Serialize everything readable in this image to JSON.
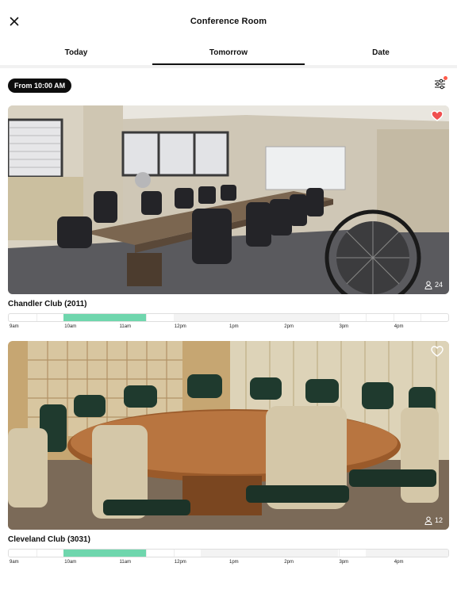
{
  "header": {
    "title": "Conference Room"
  },
  "tabs": [
    {
      "label": "Today",
      "active": false
    },
    {
      "label": "Tomorrow",
      "active": true
    },
    {
      "label": "Date",
      "active": false
    }
  ],
  "filter": {
    "time_chip": "From 10:00 AM",
    "indicator_color": "#ff5b4a"
  },
  "colors": {
    "available": "#6fd6ad",
    "unavailable": "#f3f3f3",
    "free": "#ffffff",
    "favorite": "#f05050"
  },
  "rooms": [
    {
      "name": "Chandler Club (2011)",
      "capacity": "24",
      "favorite": true,
      "timeline": {
        "start": "9am",
        "end": "5pm",
        "ticks": [
          "9am",
          "10am",
          "11am",
          "12pm",
          "1pm",
          "2pm",
          "3pm",
          "4pm"
        ],
        "segments": [
          {
            "from": "10am",
            "to": "11:30am",
            "status": "available"
          },
          {
            "from": "12pm",
            "to": "3pm",
            "status": "unavailable"
          }
        ]
      }
    },
    {
      "name": "Cleveland Club (3031)",
      "capacity": "12",
      "favorite": false,
      "timeline": {
        "start": "9am",
        "end": "5pm",
        "ticks": [
          "9am",
          "10am",
          "11am",
          "12pm",
          "1pm",
          "2pm",
          "3pm",
          "4pm"
        ],
        "segments": [
          {
            "from": "10am",
            "to": "11:30am",
            "status": "available"
          },
          {
            "from": "12:30pm",
            "to": "3pm",
            "status": "unavailable"
          },
          {
            "from": "3:30pm",
            "to": "5pm",
            "status": "unavailable"
          }
        ]
      }
    }
  ]
}
